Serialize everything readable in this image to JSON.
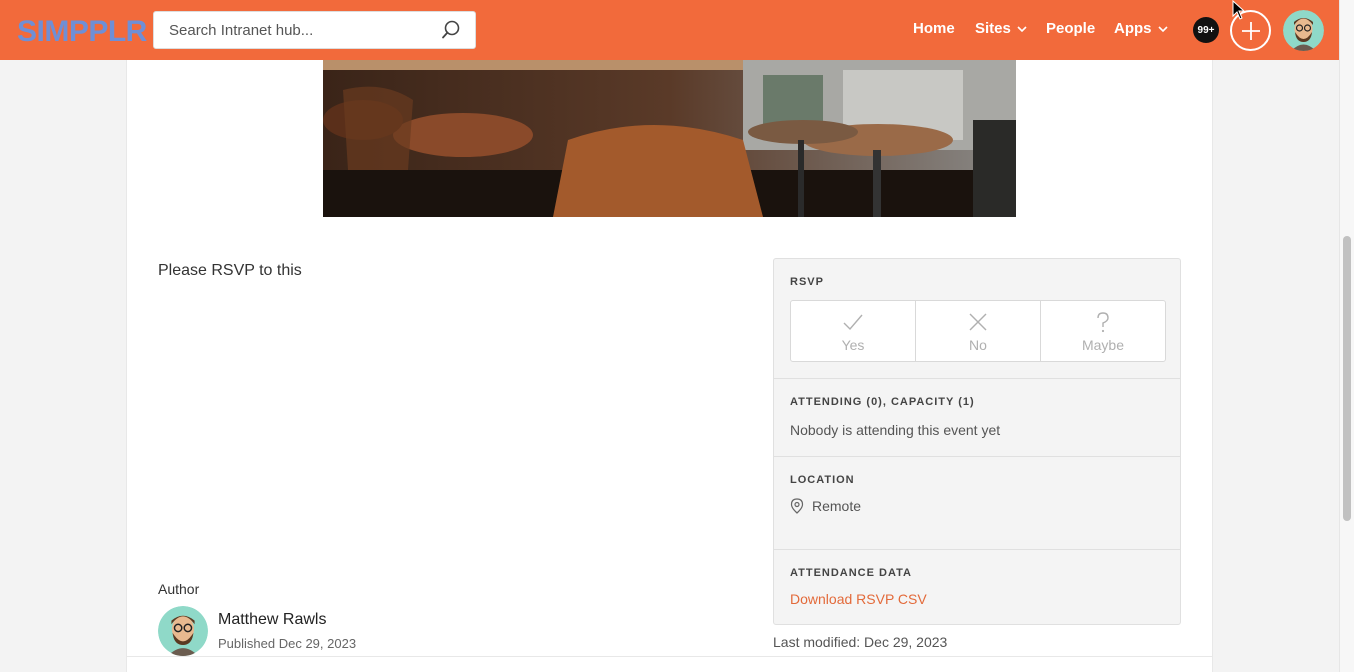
{
  "header": {
    "logo": "SIMPPLR",
    "search_placeholder": "Search Intranet hub...",
    "nav": {
      "home": "Home",
      "sites": "Sites",
      "people": "People",
      "apps": "Apps"
    },
    "notifications_count": "99+"
  },
  "event": {
    "description": "Please RSVP to this",
    "author_label": "Author",
    "author_name": "Matthew Rawls",
    "published": "Published Dec 29, 2023",
    "last_modified": "Last modified: Dec 29, 2023"
  },
  "rsvp_panel": {
    "rsvp_title": "RSVP",
    "options": {
      "yes": "Yes",
      "no": "No",
      "maybe": "Maybe"
    },
    "attending_title": "ATTENDING (0), CAPACITY (1)",
    "attending_text": "Nobody is attending this event yet",
    "location_title": "LOCATION",
    "location_value": "Remote",
    "attendance_title": "ATTENDANCE DATA",
    "download_link": "Download RSVP CSV"
  },
  "colors": {
    "brand": "#f26a3b",
    "link": "#e36a3a"
  },
  "icons": [
    "search-icon",
    "chevron-down-icon",
    "plus-icon",
    "check-icon",
    "close-icon",
    "question-icon",
    "location-pin-icon"
  ]
}
